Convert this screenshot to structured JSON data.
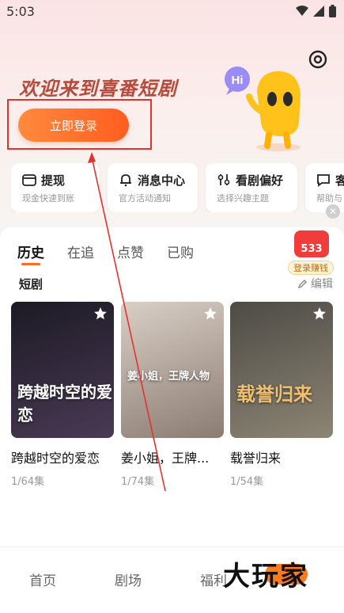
{
  "status_bar": {
    "time": "5:03"
  },
  "header": {
    "welcome_text": "欢迎来到喜番短剧",
    "login_button": "立即登录",
    "mascot_bubble": "Hi"
  },
  "quick_cards": [
    {
      "title": "提现",
      "subtitle": "现金快速到账",
      "icon": "wallet-icon"
    },
    {
      "title": "消息中心",
      "subtitle": "官方活动通知",
      "icon": "bell-icon"
    },
    {
      "title": "看剧偏好",
      "subtitle": "选择兴趣主题",
      "icon": "sliders-icon"
    },
    {
      "title": "客",
      "subtitle": "帮助与",
      "icon": "chat-icon"
    }
  ],
  "tabs": [
    "历史",
    "在追",
    "点赞",
    "已购"
  ],
  "reward_badge": {
    "count": "533",
    "label": "登录赚钱"
  },
  "section": {
    "title": "短剧",
    "edit_label": "编辑"
  },
  "dramas": [
    {
      "title": "跨越时空的爱恋",
      "progress": "1/64集",
      "poster_text": "跨越时空的爱恋",
      "poster_colors": [
        "#1c1a24",
        "#4a3a55"
      ]
    },
    {
      "title": "姜小姐，王牌...",
      "progress": "1/74集",
      "poster_text": "姜小姐，王牌人物",
      "poster_colors": [
        "#d9cfc6",
        "#8b7c72"
      ]
    },
    {
      "title": "载誉归来",
      "progress": "1/54集",
      "poster_text": "载誉归来",
      "poster_colors": [
        "#4d4b46",
        "#8d8574"
      ]
    }
  ],
  "bottom_nav": [
    "首页",
    "剧场",
    "福利"
  ],
  "watermark": "大玩家",
  "colors": {
    "accent": "#ff6a28",
    "annotation_red": "#e5322d"
  }
}
